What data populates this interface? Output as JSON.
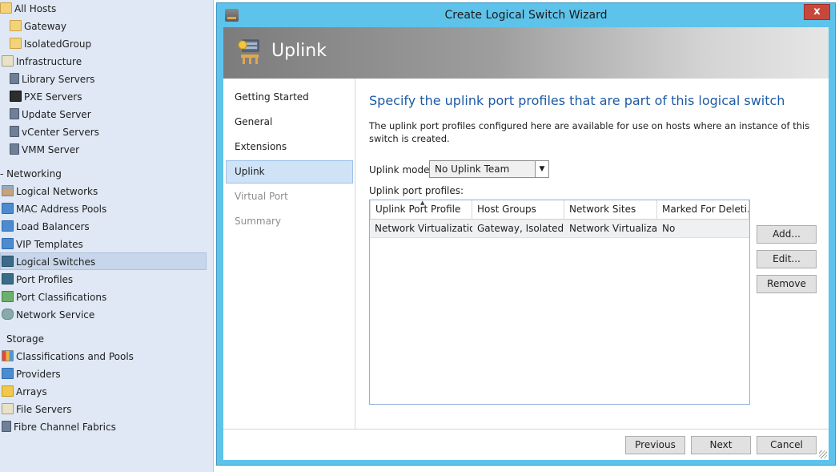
{
  "tree": {
    "items": [
      {
        "label": "All Hosts",
        "icon": "folder-icon"
      },
      {
        "label": "Gateway",
        "icon": "folder-icon"
      },
      {
        "label": "IsolatedGroup",
        "icon": "folder-icon"
      },
      {
        "label": "Infrastructure",
        "icon": "infrastructure-icon"
      },
      {
        "label": "Library Servers",
        "icon": "server-icon"
      },
      {
        "label": "PXE Servers",
        "icon": "pxe-server-icon"
      },
      {
        "label": "Update Server",
        "icon": "update-server-icon"
      },
      {
        "label": "vCenter Servers",
        "icon": "server-icon"
      },
      {
        "label": "VMM Server",
        "icon": "server-icon"
      },
      {
        "label": "- Networking",
        "icon": ""
      },
      {
        "label": "Logical Networks",
        "icon": "logical-networks-icon"
      },
      {
        "label": "MAC Address Pools",
        "icon": "mac-pool-icon"
      },
      {
        "label": "Load Balancers",
        "icon": "load-balancer-icon"
      },
      {
        "label": "VIP Templates",
        "icon": "vip-template-icon"
      },
      {
        "label": "Logical Switches",
        "icon": "logical-switch-icon"
      },
      {
        "label": "Port Profiles",
        "icon": "port-profile-icon"
      },
      {
        "label": "Port Classifications",
        "icon": "port-classification-icon"
      },
      {
        "label": "Network Service",
        "icon": "network-service-icon"
      },
      {
        "label": "Storage",
        "icon": ""
      },
      {
        "label": "Classifications and Pools",
        "icon": "classifications-icon"
      },
      {
        "label": "Providers",
        "icon": "providers-icon"
      },
      {
        "label": "Arrays",
        "icon": "arrays-icon"
      },
      {
        "label": "File Servers",
        "icon": "file-server-icon"
      },
      {
        "label": "Fibre Channel Fabrics",
        "icon": "fibre-channel-icon"
      }
    ],
    "selected": "Logical Switches"
  },
  "dialog": {
    "title": "Create Logical Switch Wizard",
    "close_label": "x",
    "header_title": "Uplink",
    "nav": [
      {
        "label": "Getting Started",
        "state": "normal"
      },
      {
        "label": "General",
        "state": "normal"
      },
      {
        "label": "Extensions",
        "state": "normal"
      },
      {
        "label": "Uplink",
        "state": "current"
      },
      {
        "label": "Virtual Port",
        "state": "disabled"
      },
      {
        "label": "Summary",
        "state": "disabled"
      }
    ],
    "heading": "Specify the uplink port profiles that are part of this logical switch",
    "description": "The uplink port profiles configured here are available for use on hosts where an instance of this switch is created.",
    "uplink_mode_label": "Uplink mode:",
    "uplink_mode_value": "No Uplink Team",
    "profiles_label": "Uplink port profiles:",
    "grid": {
      "columns": [
        "Uplink Port Profile",
        "Host Groups",
        "Network Sites",
        "Marked For Deleti..."
      ],
      "rows": [
        [
          "Network Virtualization",
          "Gateway, Isolated...",
          "Network Virtualiza...",
          "No"
        ]
      ]
    },
    "buttons": {
      "add": "Add...",
      "edit": "Edit...",
      "remove": "Remove",
      "previous": "Previous",
      "next": "Next",
      "cancel": "Cancel"
    }
  }
}
